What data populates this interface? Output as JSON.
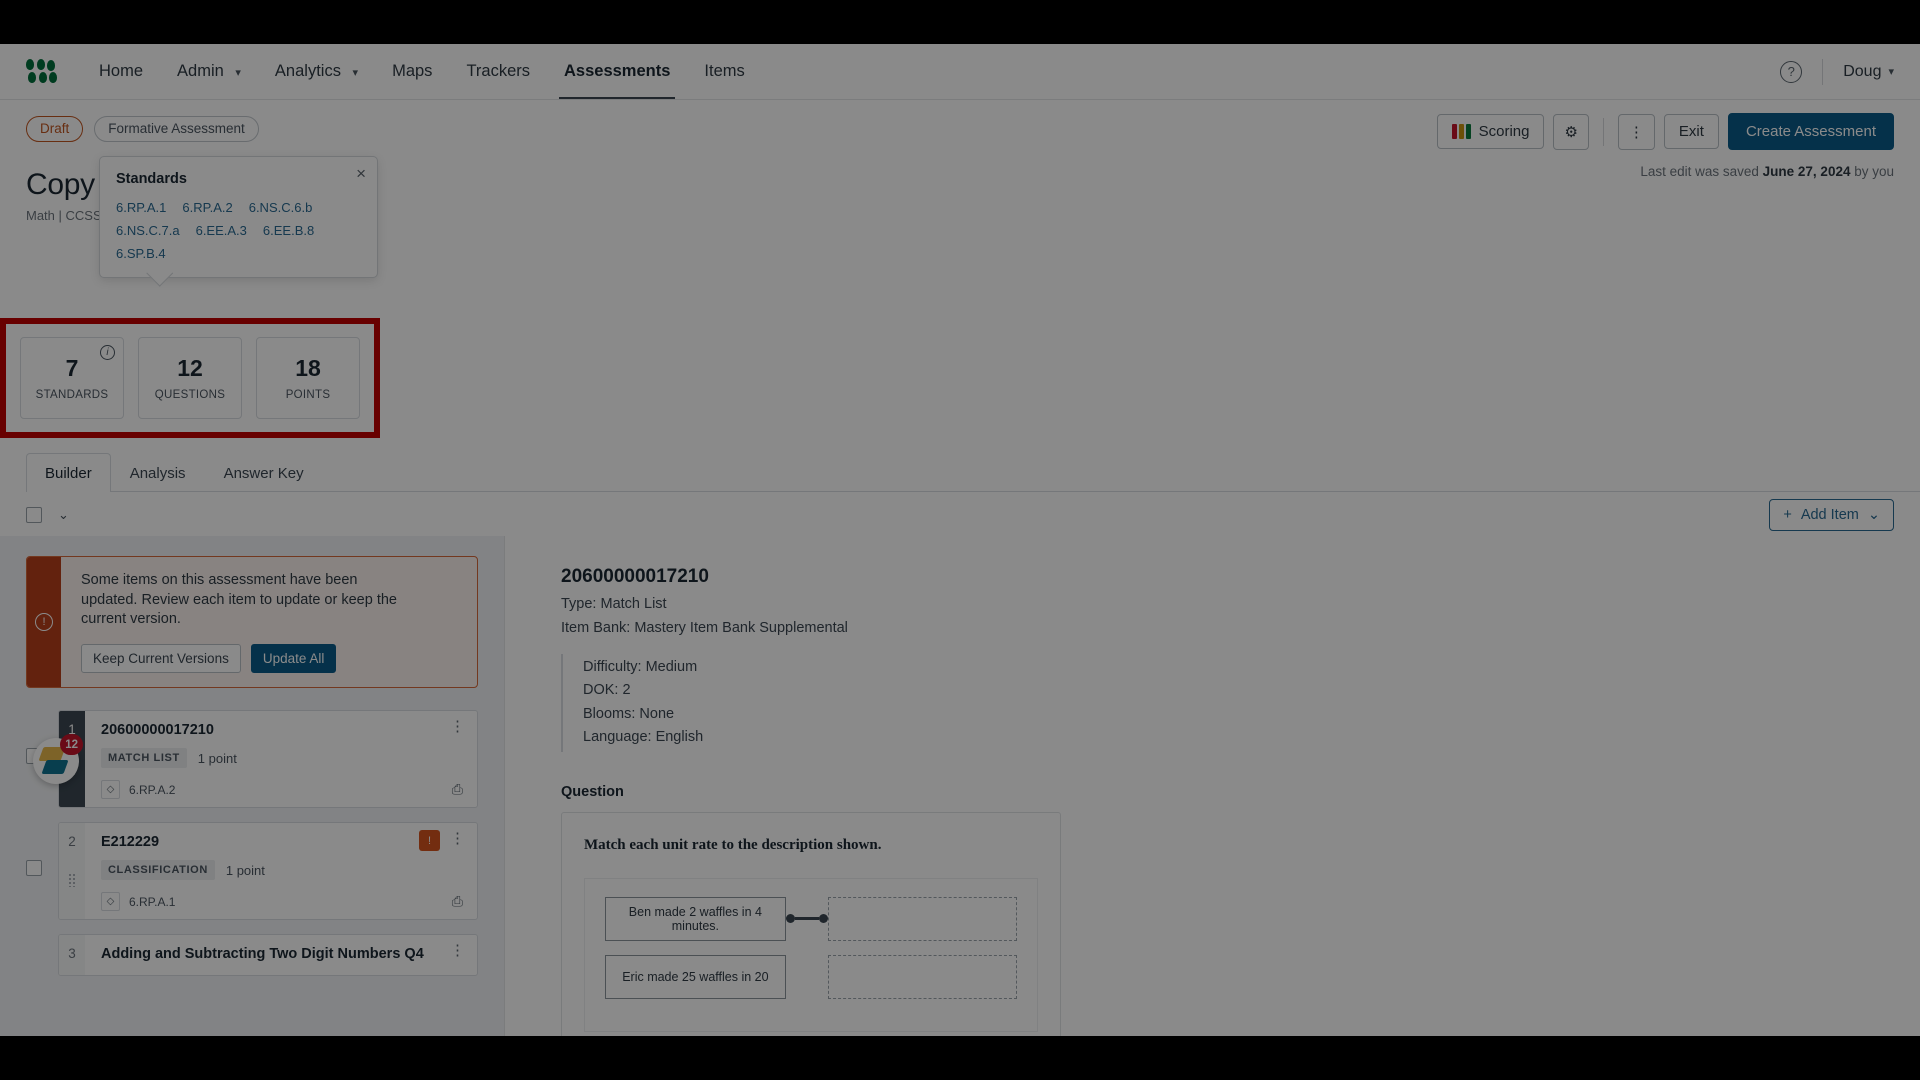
{
  "nav": {
    "logo_name": "app-logo",
    "items": [
      {
        "label": "Home",
        "has_caret": false,
        "active": false
      },
      {
        "label": "Admin",
        "has_caret": true,
        "active": false
      },
      {
        "label": "Analytics",
        "has_caret": true,
        "active": false
      },
      {
        "label": "Maps",
        "has_caret": false,
        "active": false
      },
      {
        "label": "Trackers",
        "has_caret": false,
        "active": false
      },
      {
        "label": "Assessments",
        "has_caret": false,
        "active": true
      },
      {
        "label": "Items",
        "has_caret": false,
        "active": false
      }
    ],
    "help_label": "?",
    "user_label": "Doug",
    "user_caret": "⌄"
  },
  "header": {
    "status_badge": "Draft",
    "type_badge": "Formative Assessment",
    "scoring_label": "Scoring",
    "gear_icon": "⚙",
    "kebab_icon": "⋮",
    "exit_label": "Exit",
    "create_label": "Create Assessment",
    "last_edit_prefix": "Last edit was saved ",
    "last_edit_date": "June 27, 2024",
    "last_edit_suffix": " by you",
    "title": "Copy Ser",
    "subtitle": "Math | CCSS: Tradit"
  },
  "standards_popover": {
    "title": "Standards",
    "close_label": "×",
    "standards": [
      "6.RP.A.1",
      "6.RP.A.2",
      "6.NS.C.6.b",
      "6.NS.C.7.a",
      "6.EE.A.3",
      "6.EE.B.8",
      "6.SP.B.4"
    ]
  },
  "stats": {
    "highlight_color": "#c00000",
    "info_icon_label": "i",
    "cards": [
      {
        "value": "7",
        "label": "STANDARDS",
        "has_info": true
      },
      {
        "value": "12",
        "label": "QUESTIONS",
        "has_info": false
      },
      {
        "value": "18",
        "label": "POINTS",
        "has_info": false
      }
    ]
  },
  "tabs": [
    {
      "label": "Builder",
      "active": true
    },
    {
      "label": "Analysis",
      "active": false
    },
    {
      "label": "Answer Key",
      "active": false
    }
  ],
  "toolbar": {
    "chevron": "⌄",
    "add_item_plus": "+",
    "add_item_label": "Add Item",
    "add_item_caret": "⌄"
  },
  "alert": {
    "icon": "!",
    "message": "Some items on this assessment have been updated. Review each item to update or keep the current version.",
    "keep_label": "Keep Current Versions",
    "update_label": "Update All"
  },
  "items": [
    {
      "index": "1",
      "title": "20600000017210",
      "type": "MATCH LIST",
      "points": "1 point",
      "standard": "6.RP.A.2",
      "selected": true,
      "has_update_flag": false,
      "kebab": "⋮",
      "print_icon": "⎙",
      "tag_icon": "◇"
    },
    {
      "index": "2",
      "title": "E212229",
      "type": "CLASSIFICATION",
      "points": "1 point",
      "standard": "6.RP.A.1",
      "selected": false,
      "has_update_flag": true,
      "kebab": "⋮",
      "print_icon": "⎙",
      "tag_icon": "◇"
    },
    {
      "index": "3",
      "title": "Adding and Subtracting Two Digit Numbers Q4",
      "type": "",
      "points": "",
      "standard": "",
      "selected": false,
      "has_update_flag": false,
      "kebab": "⋮",
      "print_icon": "",
      "tag_icon": ""
    }
  ],
  "detail": {
    "id": "20600000017210",
    "type_line": "Type: Match List",
    "bank_line": "Item Bank: Mastery Item Bank Supplemental",
    "meta": [
      "Difficulty: Medium",
      "DOK: 2",
      "Blooms: None",
      "Language: English"
    ],
    "question_label": "Question",
    "prompt": "Match each unit rate to the description shown.",
    "pairs": [
      {
        "left": "Ben made 2 waffles in 4 minutes.",
        "connected": true
      },
      {
        "left": "Eric made 25 waffles in 20",
        "connected": false
      }
    ]
  },
  "chat": {
    "badge_count": "12"
  }
}
